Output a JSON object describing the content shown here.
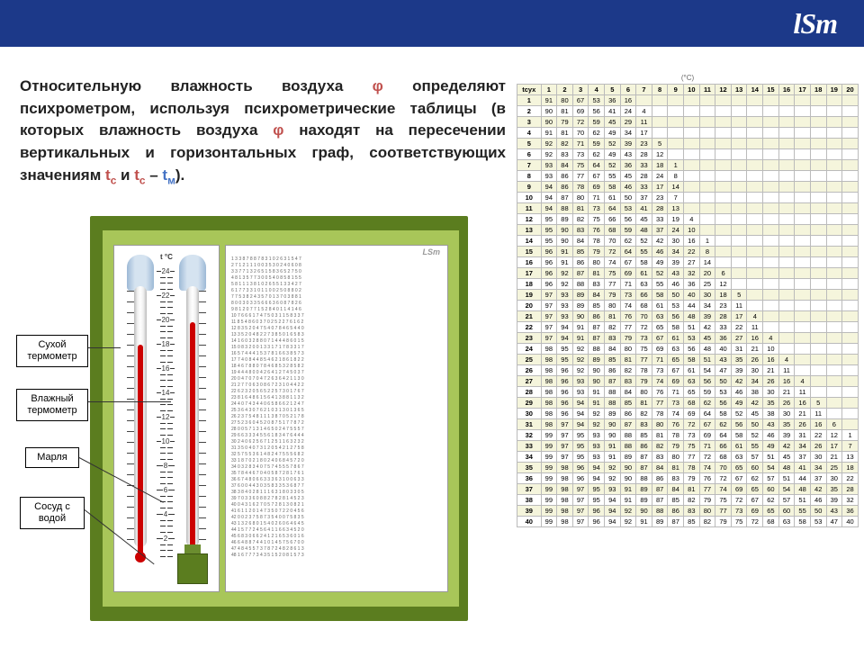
{
  "logo": "lSm",
  "desc": {
    "p1_a": "Относительную влажность воздуха ",
    "phi1": "φ",
    "p1_b": " определяют психрометром, используя психрометрические таблицы (в которых влажность воздуха ",
    "phi2": "φ",
    "p1_c": " находят на пересечении вертикальных и горизонтальных граф, соответствующих значениям ",
    "tc": "t",
    "tc_sub": "с",
    "and": " и ",
    "tc2": "t",
    "tc2_sub": "с",
    "minus": " – ",
    "tm": "t",
    "tm_sub": "м",
    "end": ")."
  },
  "labels": {
    "dry": "Сухой термометр",
    "wet": "Влажный термометр",
    "gauze": "Марля",
    "vessel": "Сосуд с водой"
  },
  "scale_label": "t °C",
  "scale_ticks": [
    "24",
    "22",
    "20",
    "18",
    "16",
    "14",
    "12",
    "10",
    "8",
    "6",
    "4",
    "2"
  ],
  "mini_logo": "LSm",
  "table_header_unit": "(°C)",
  "table": {
    "row_label": "tсух",
    "cols": [
      "1",
      "2",
      "3",
      "4",
      "5",
      "6",
      "7",
      "8",
      "9",
      "10",
      "11",
      "12",
      "13",
      "14",
      "15",
      "16",
      "17",
      "18",
      "19",
      "20"
    ],
    "rows": [
      {
        "t": "1",
        "v": [
          "91",
          "80",
          "67",
          "53",
          "36",
          "16",
          "",
          "",
          "",
          "",
          "",
          "",
          "",
          "",
          "",
          "",
          "",
          "",
          "",
          ""
        ]
      },
      {
        "t": "2",
        "v": [
          "90",
          "81",
          "69",
          "56",
          "41",
          "24",
          "4",
          "",
          "",
          "",
          "",
          "",
          "",
          "",
          "",
          "",
          "",
          "",
          "",
          ""
        ]
      },
      {
        "t": "3",
        "v": [
          "90",
          "79",
          "72",
          "59",
          "45",
          "29",
          "11",
          "",
          "",
          "",
          "",
          "",
          "",
          "",
          "",
          "",
          "",
          "",
          "",
          ""
        ]
      },
      {
        "t": "4",
        "v": [
          "91",
          "81",
          "70",
          "62",
          "49",
          "34",
          "17",
          "",
          "",
          "",
          "",
          "",
          "",
          "",
          "",
          "",
          "",
          "",
          "",
          ""
        ]
      },
      {
        "t": "5",
        "v": [
          "92",
          "82",
          "71",
          "59",
          "52",
          "39",
          "23",
          "5",
          "",
          "",
          "",
          "",
          "",
          "",
          "",
          "",
          "",
          "",
          "",
          ""
        ]
      },
      {
        "t": "6",
        "v": [
          "92",
          "83",
          "73",
          "62",
          "49",
          "43",
          "28",
          "12",
          "",
          "",
          "",
          "",
          "",
          "",
          "",
          "",
          "",
          "",
          "",
          ""
        ]
      },
      {
        "t": "7",
        "v": [
          "93",
          "84",
          "75",
          "64",
          "52",
          "36",
          "33",
          "18",
          "1",
          "",
          "",
          "",
          "",
          "",
          "",
          "",
          "",
          "",
          "",
          ""
        ]
      },
      {
        "t": "8",
        "v": [
          "93",
          "86",
          "77",
          "67",
          "55",
          "45",
          "28",
          "24",
          "8",
          "",
          "",
          "",
          "",
          "",
          "",
          "",
          "",
          "",
          "",
          ""
        ]
      },
      {
        "t": "9",
        "v": [
          "94",
          "86",
          "78",
          "69",
          "58",
          "46",
          "33",
          "17",
          "14",
          "",
          "",
          "",
          "",
          "",
          "",
          "",
          "",
          "",
          "",
          ""
        ]
      },
      {
        "t": "10",
        "v": [
          "94",
          "87",
          "80",
          "71",
          "61",
          "50",
          "37",
          "23",
          "7",
          "",
          "",
          "",
          "",
          "",
          "",
          "",
          "",
          "",
          "",
          ""
        ]
      },
      {
        "t": "11",
        "v": [
          "94",
          "88",
          "81",
          "73",
          "64",
          "53",
          "41",
          "28",
          "13",
          "",
          "",
          "",
          "",
          "",
          "",
          "",
          "",
          "",
          "",
          ""
        ]
      },
      {
        "t": "12",
        "v": [
          "95",
          "89",
          "82",
          "75",
          "66",
          "56",
          "45",
          "33",
          "19",
          "4",
          "",
          "",
          "",
          "",
          "",
          "",
          "",
          "",
          "",
          ""
        ]
      },
      {
        "t": "13",
        "v": [
          "95",
          "90",
          "83",
          "76",
          "68",
          "59",
          "48",
          "37",
          "24",
          "10",
          "",
          "",
          "",
          "",
          "",
          "",
          "",
          "",
          "",
          ""
        ]
      },
      {
        "t": "14",
        "v": [
          "95",
          "90",
          "84",
          "78",
          "70",
          "62",
          "52",
          "42",
          "30",
          "16",
          "1",
          "",
          "",
          "",
          "",
          "",
          "",
          "",
          "",
          ""
        ]
      },
      {
        "t": "15",
        "v": [
          "96",
          "91",
          "85",
          "79",
          "72",
          "64",
          "55",
          "46",
          "34",
          "22",
          "8",
          "",
          "",
          "",
          "",
          "",
          "",
          "",
          "",
          ""
        ]
      },
      {
        "t": "16",
        "v": [
          "96",
          "91",
          "86",
          "80",
          "74",
          "67",
          "58",
          "49",
          "39",
          "27",
          "14",
          "",
          "",
          "",
          "",
          "",
          "",
          "",
          "",
          ""
        ]
      },
      {
        "t": "17",
        "v": [
          "96",
          "92",
          "87",
          "81",
          "75",
          "69",
          "61",
          "52",
          "43",
          "32",
          "20",
          "6",
          "",
          "",
          "",
          "",
          "",
          "",
          "",
          ""
        ]
      },
      {
        "t": "18",
        "v": [
          "96",
          "92",
          "88",
          "83",
          "77",
          "71",
          "63",
          "55",
          "46",
          "36",
          "25",
          "12",
          "",
          "",
          "",
          "",
          "",
          "",
          "",
          ""
        ]
      },
      {
        "t": "19",
        "v": [
          "97",
          "93",
          "89",
          "84",
          "79",
          "73",
          "66",
          "58",
          "50",
          "40",
          "30",
          "18",
          "5",
          "",
          "",
          "",
          "",
          "",
          "",
          ""
        ]
      },
      {
        "t": "20",
        "v": [
          "97",
          "93",
          "89",
          "85",
          "80",
          "74",
          "68",
          "61",
          "53",
          "44",
          "34",
          "23",
          "11",
          "",
          "",
          "",
          "",
          "",
          "",
          ""
        ]
      },
      {
        "t": "21",
        "v": [
          "97",
          "93",
          "90",
          "86",
          "81",
          "76",
          "70",
          "63",
          "56",
          "48",
          "39",
          "28",
          "17",
          "4",
          "",
          "",
          "",
          "",
          "",
          ""
        ]
      },
      {
        "t": "22",
        "v": [
          "97",
          "94",
          "91",
          "87",
          "82",
          "77",
          "72",
          "65",
          "58",
          "51",
          "42",
          "33",
          "22",
          "11",
          "",
          "",
          "",
          "",
          "",
          ""
        ]
      },
      {
        "t": "23",
        "v": [
          "97",
          "94",
          "91",
          "87",
          "83",
          "79",
          "73",
          "67",
          "61",
          "53",
          "45",
          "36",
          "27",
          "16",
          "4",
          "",
          "",
          "",
          "",
          ""
        ]
      },
      {
        "t": "24",
        "v": [
          "98",
          "95",
          "92",
          "88",
          "84",
          "80",
          "75",
          "69",
          "63",
          "56",
          "48",
          "40",
          "31",
          "21",
          "10",
          "",
          "",
          "",
          "",
          ""
        ]
      },
      {
        "t": "25",
        "v": [
          "98",
          "95",
          "92",
          "89",
          "85",
          "81",
          "77",
          "71",
          "65",
          "58",
          "51",
          "43",
          "35",
          "26",
          "16",
          "4",
          "",
          "",
          "",
          ""
        ]
      },
      {
        "t": "26",
        "v": [
          "98",
          "96",
          "92",
          "90",
          "86",
          "82",
          "78",
          "73",
          "67",
          "61",
          "54",
          "47",
          "39",
          "30",
          "21",
          "11",
          "",
          "",
          "",
          ""
        ]
      },
      {
        "t": "27",
        "v": [
          "98",
          "96",
          "93",
          "90",
          "87",
          "83",
          "79",
          "74",
          "69",
          "63",
          "56",
          "50",
          "42",
          "34",
          "26",
          "16",
          "4",
          "",
          "",
          ""
        ]
      },
      {
        "t": "28",
        "v": [
          "98",
          "96",
          "93",
          "91",
          "88",
          "84",
          "80",
          "76",
          "71",
          "65",
          "59",
          "53",
          "46",
          "38",
          "30",
          "21",
          "11",
          "",
          "",
          ""
        ]
      },
      {
        "t": "29",
        "v": [
          "98",
          "96",
          "94",
          "91",
          "88",
          "85",
          "81",
          "77",
          "73",
          "68",
          "62",
          "56",
          "49",
          "42",
          "35",
          "26",
          "16",
          "5",
          "",
          ""
        ]
      },
      {
        "t": "30",
        "v": [
          "98",
          "96",
          "94",
          "92",
          "89",
          "86",
          "82",
          "78",
          "74",
          "69",
          "64",
          "58",
          "52",
          "45",
          "38",
          "30",
          "21",
          "11",
          "",
          ""
        ]
      },
      {
        "t": "31",
        "v": [
          "98",
          "97",
          "94",
          "92",
          "90",
          "87",
          "83",
          "80",
          "76",
          "72",
          "67",
          "62",
          "56",
          "50",
          "43",
          "35",
          "26",
          "16",
          "6",
          ""
        ]
      },
      {
        "t": "32",
        "v": [
          "99",
          "97",
          "95",
          "93",
          "90",
          "88",
          "85",
          "81",
          "78",
          "73",
          "69",
          "64",
          "58",
          "52",
          "46",
          "39",
          "31",
          "22",
          "12",
          "1"
        ]
      },
      {
        "t": "33",
        "v": [
          "99",
          "97",
          "95",
          "93",
          "91",
          "88",
          "86",
          "82",
          "79",
          "75",
          "71",
          "66",
          "61",
          "55",
          "49",
          "42",
          "34",
          "26",
          "17",
          "7"
        ]
      },
      {
        "t": "34",
        "v": [
          "99",
          "97",
          "95",
          "93",
          "91",
          "89",
          "87",
          "83",
          "80",
          "77",
          "72",
          "68",
          "63",
          "57",
          "51",
          "45",
          "37",
          "30",
          "21",
          "13"
        ]
      },
      {
        "t": "35",
        "v": [
          "99",
          "98",
          "96",
          "94",
          "92",
          "90",
          "87",
          "84",
          "81",
          "78",
          "74",
          "70",
          "65",
          "60",
          "54",
          "48",
          "41",
          "34",
          "25",
          "18"
        ]
      },
      {
        "t": "36",
        "v": [
          "99",
          "98",
          "96",
          "94",
          "92",
          "90",
          "88",
          "86",
          "83",
          "79",
          "76",
          "72",
          "67",
          "62",
          "57",
          "51",
          "44",
          "37",
          "30",
          "22"
        ]
      },
      {
        "t": "37",
        "v": [
          "99",
          "98",
          "97",
          "95",
          "93",
          "91",
          "89",
          "87",
          "84",
          "81",
          "77",
          "74",
          "69",
          "65",
          "60",
          "54",
          "48",
          "42",
          "35",
          "28"
        ]
      },
      {
        "t": "38",
        "v": [
          "99",
          "98",
          "97",
          "95",
          "94",
          "91",
          "89",
          "87",
          "85",
          "82",
          "79",
          "75",
          "72",
          "67",
          "62",
          "57",
          "51",
          "46",
          "39",
          "32"
        ]
      },
      {
        "t": "39",
        "v": [
          "99",
          "98",
          "97",
          "96",
          "94",
          "92",
          "90",
          "88",
          "86",
          "83",
          "80",
          "77",
          "73",
          "69",
          "65",
          "60",
          "55",
          "50",
          "43",
          "36"
        ]
      },
      {
        "t": "40",
        "v": [
          "99",
          "98",
          "97",
          "96",
          "94",
          "92",
          "91",
          "89",
          "87",
          "85",
          "82",
          "79",
          "75",
          "72",
          "68",
          "63",
          "58",
          "53",
          "47",
          "40"
        ]
      }
    ],
    "extra_col": {
      "32": "1",
      "33": "7",
      "34": "13",
      "35": "18",
      "36": "22",
      "37": "28",
      "38": "32",
      "39": "36",
      "40": "40"
    }
  }
}
